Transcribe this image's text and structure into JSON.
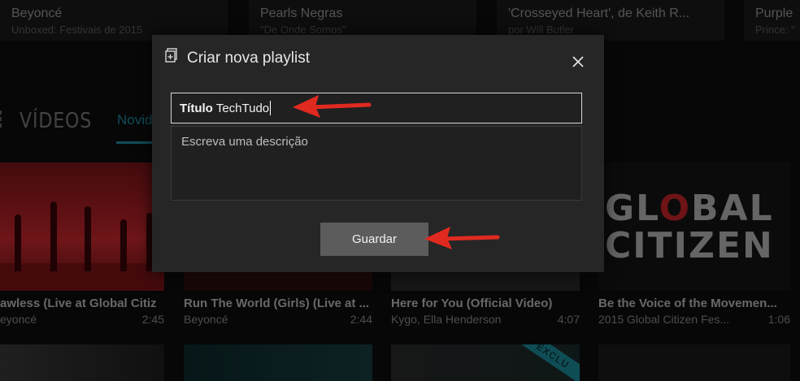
{
  "top_cards": [
    {
      "title": "Beyoncé",
      "subtitle": "Unboxed: Festivais de 2015"
    },
    {
      "title": "Pearls Negras",
      "subtitle": "\"De Onde Somos\""
    },
    {
      "title": "'Crosseyed Heart', de Keith R...",
      "subtitle": "por Will Butler"
    },
    {
      "title": "Purple",
      "subtitle": "Prince: \""
    }
  ],
  "section": {
    "title": "VÍDEOS",
    "active_tab": "Novid"
  },
  "thumbnail_text": {
    "gc_line1": "GL",
    "gc_o": "O",
    "gc_line1_end": "BAL",
    "gc_line2": "CITIZEN",
    "ribbon": "EXCLU"
  },
  "videos": [
    {
      "title": "awless (Live at Global Citiz",
      "channel": "eyoncé",
      "duration": "2:45"
    },
    {
      "title": "Run The World (Girls) (Live at ...",
      "channel": "Beyoncé",
      "duration": "2:44"
    },
    {
      "title": "Here for You (Official Video)",
      "channel": "Kygo, Ella Henderson",
      "duration": "4:07"
    },
    {
      "title": "Be the Voice of the Movemen...",
      "channel": "2015 Global Citizen Fes...",
      "duration": "1:06"
    }
  ],
  "dialog": {
    "title": "Criar nova playlist",
    "title_field_label": "Título",
    "title_field_value": "TechTudo",
    "description_placeholder": "Escreva uma descrição",
    "save_label": "Guardar"
  },
  "icons": {
    "close": "close-icon",
    "playlist": "playlist-add-icon",
    "arrow": "red-arrow-icon"
  },
  "colors": {
    "accent": "#1f8aa0",
    "annotation_arrow": "#e02a20",
    "dialog_bg": "#262626"
  }
}
